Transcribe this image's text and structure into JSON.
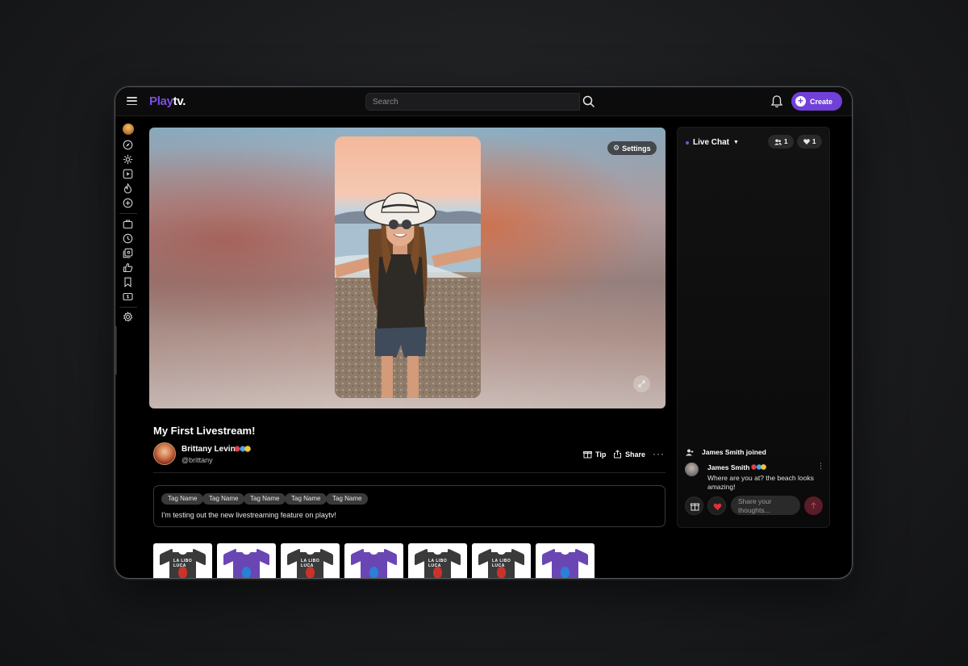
{
  "app": {
    "logo_part1": "Play",
    "logo_part2": "tv",
    "logo_suffix": ".",
    "accent_color": "#7140d9"
  },
  "header": {
    "search_placeholder": "Search",
    "create_label": "Create",
    "icons": [
      "menu-icon",
      "search-icon",
      "bell-icon",
      "plus-icon"
    ]
  },
  "sidebar": {
    "items": [
      {
        "icon": "avatar"
      },
      {
        "icon": "compass-icon"
      },
      {
        "icon": "sparkle-icon"
      },
      {
        "icon": "play-square-icon"
      },
      {
        "icon": "flame-icon"
      },
      {
        "icon": "plus-circle-icon"
      },
      {
        "icon": "briefcase-icon"
      },
      {
        "icon": "history-icon"
      },
      {
        "icon": "playlist-icon"
      },
      {
        "icon": "thumbs-up-icon"
      },
      {
        "icon": "bookmark-icon"
      },
      {
        "icon": "money-icon"
      },
      {
        "icon": "gear-icon"
      }
    ]
  },
  "player": {
    "settings_label": "Settings"
  },
  "stream": {
    "title": "My First Livestream!",
    "streamer_name": "Brittany Levin",
    "streamer_handle": "@brittany",
    "tip_label": "Tip",
    "share_label": "Share",
    "more_label": "···",
    "tags": [
      "Tag Name",
      "Tag Name",
      "Tag Name",
      "Tag Name",
      "Tag Name"
    ],
    "description": "I'm testing out the new livestreaming feature on playtv!"
  },
  "products": [
    {
      "color": "#3a3a3a",
      "print_text": "LA LIBO LUCA",
      "print_color": "#c9332a"
    },
    {
      "color": "#6a46b5",
      "print_text": "",
      "print_color": "#2a7fd6"
    },
    {
      "color": "#3a3a3a",
      "print_text": "LA LIBO LUCA",
      "print_color": "#c9332a"
    },
    {
      "color": "#6a46b5",
      "print_text": "",
      "print_color": "#2a7fd6"
    },
    {
      "color": "#3a3a3a",
      "print_text": "LA LIBO LUCA",
      "print_color": "#c9332a"
    },
    {
      "color": "#3a3a3a",
      "print_text": "LA LIBO LUCA",
      "print_color": "#c9332a"
    },
    {
      "color": "#6a46b5",
      "print_text": "",
      "print_color": "#2a7fd6"
    }
  ],
  "chat": {
    "header": "Live Chat",
    "viewers_count": "1",
    "likes_count": "1",
    "system_message": "James Smith joined",
    "messages": [
      {
        "name": "James Smith",
        "text": "Where are you at? the beach looks amazing!"
      }
    ],
    "input_placeholder": "Share your thoughts..."
  }
}
